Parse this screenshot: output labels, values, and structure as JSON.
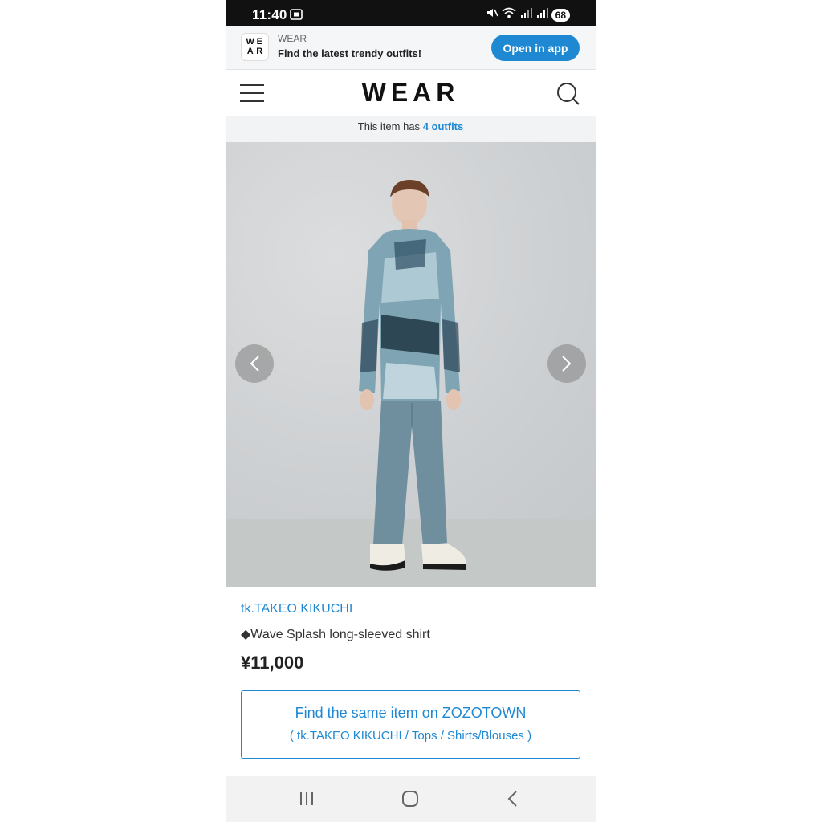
{
  "status_bar": {
    "time": "11:40",
    "battery": "68",
    "icons": [
      "screen-record-icon",
      "mute-icon",
      "wifi-icon",
      "signal-icon",
      "signal-icon"
    ]
  },
  "app_banner": {
    "logo_letters": [
      "W",
      "E",
      "A",
      "R"
    ],
    "app_name": "WEAR",
    "tagline": "Find the latest trendy outfits!",
    "open_button": "Open in app"
  },
  "header": {
    "logo": "WEAR",
    "menu_icon": "hamburger-menu-icon",
    "search_icon": "search-icon"
  },
  "outfit_info": {
    "prefix": "This item has",
    "link_text": "4 outfits"
  },
  "product": {
    "brand": "tk.TAKEO KIKUCHI",
    "name": "◆Wave Splash long-sleeved shirt",
    "price": "¥11,000"
  },
  "zozo_button": {
    "title": "Find the same item on ZOZOTOWN",
    "subtitle": "( tk.TAKEO KIKUCHI / Tops / Shirts/Blouses )"
  },
  "colors": {
    "accent": "#1e88d3",
    "status_bar": "#111111",
    "banner_bg": "#f4f6f8"
  }
}
